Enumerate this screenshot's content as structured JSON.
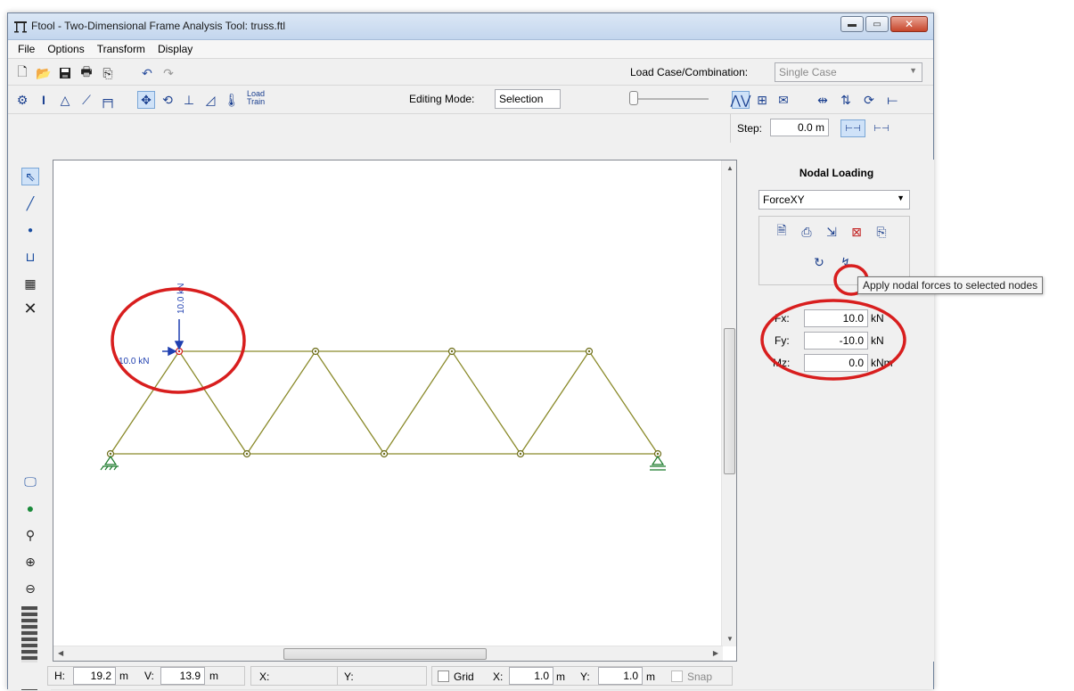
{
  "window": {
    "title": "Ftool - Two-Dimensional Frame Analysis Tool: truss.ftl",
    "controls": {
      "minimize": "▬",
      "maximize": "▭",
      "close": "✕"
    }
  },
  "menu": [
    "File",
    "Options",
    "Transform",
    "Display"
  ],
  "toolbar1": {
    "icons": [
      "new-file-icon",
      "open-folder-icon",
      "save-icon",
      "print-icon",
      "copy-icon",
      "undo-icon",
      "redo-icon"
    ],
    "load_case_label": "Load Case/Combination:",
    "load_case_value": "Single Case"
  },
  "toolbar2": {
    "load_train_label": "Load\nTrain",
    "editing_mode_label": "Editing Mode:",
    "editing_mode_value": "Selection"
  },
  "toolbar3": {
    "step_label": "Step:",
    "step_value": "0.0 m"
  },
  "panel": {
    "title": "Nodal Loading",
    "load_type": "ForceXY",
    "fx_label": "Fx:",
    "fx_value": "10.0",
    "fx_unit": "kN",
    "fy_label": "Fy:",
    "fy_value": "-10.0",
    "fy_unit": "kN",
    "mz_label": "Mz:",
    "mz_value": "0.0",
    "mz_unit": "kNm"
  },
  "tooltip": "Apply nodal forces to selected nodes",
  "drawing": {
    "load_vertical_label": "10.0 kN",
    "load_horizontal_label": "10.0 kN"
  },
  "status": {
    "h_label": "H:",
    "h_value": "19.2",
    "h_unit": "m",
    "v_label": "V:",
    "v_value": "13.9",
    "v_unit": "m",
    "x_label": "X:",
    "y_label": "Y:",
    "grid_label": "Grid",
    "gx_label": "X:",
    "gx_value": "1.0",
    "gx_unit": "m",
    "gy_label": "Y:",
    "gy_value": "1.0",
    "gy_unit": "m",
    "snap_label": "Snap"
  },
  "colors": {
    "truss": "#8a8a2a",
    "load": "#1f3fb0",
    "annotation": "#d81e1e"
  }
}
